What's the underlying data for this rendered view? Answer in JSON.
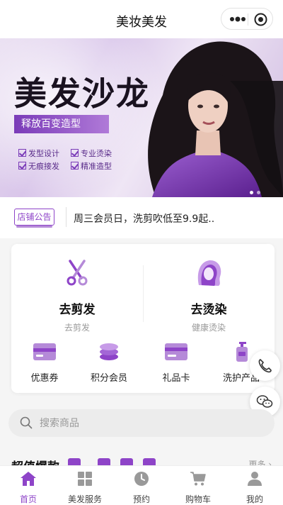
{
  "header": {
    "title": "美妆美发"
  },
  "banner": {
    "headline": "美发沙龙",
    "subtitle": "释放百变造型",
    "features": [
      "发型设计",
      "专业烫染",
      "无痕接发",
      "精准造型"
    ],
    "slide_count": 2,
    "active_slide": 1
  },
  "notice": {
    "tag": "店铺公告",
    "text": "周三会员日，洗剪吹低至9.9起.."
  },
  "services": [
    {
      "title": "去剪发",
      "subtitle": "去剪发",
      "icon": "scissors-icon"
    },
    {
      "title": "去烫染",
      "subtitle": "健康烫染",
      "icon": "hair-icon"
    }
  ],
  "quick": [
    {
      "label": "优惠券",
      "icon": "coupon-icon"
    },
    {
      "label": "积分会员",
      "icon": "points-icon"
    },
    {
      "label": "礼品卡",
      "icon": "gift-card-icon"
    },
    {
      "label": "洗护产品",
      "icon": "shampoo-icon"
    }
  ],
  "search": {
    "placeholder": "搜索商品"
  },
  "hot": {
    "title": "超值爆款",
    "more": "更多 ›"
  },
  "tabs": [
    {
      "label": "首页",
      "icon": "home-icon",
      "active": true
    },
    {
      "label": "美发服务",
      "icon": "grid-icon",
      "active": false
    },
    {
      "label": "预约",
      "icon": "clock-icon",
      "active": false
    },
    {
      "label": "购物车",
      "icon": "cart-icon",
      "active": false
    },
    {
      "label": "我的",
      "icon": "user-icon",
      "active": false
    }
  ],
  "colors": {
    "accent": "#8e44c8",
    "accent_light": "#b58ad8"
  }
}
